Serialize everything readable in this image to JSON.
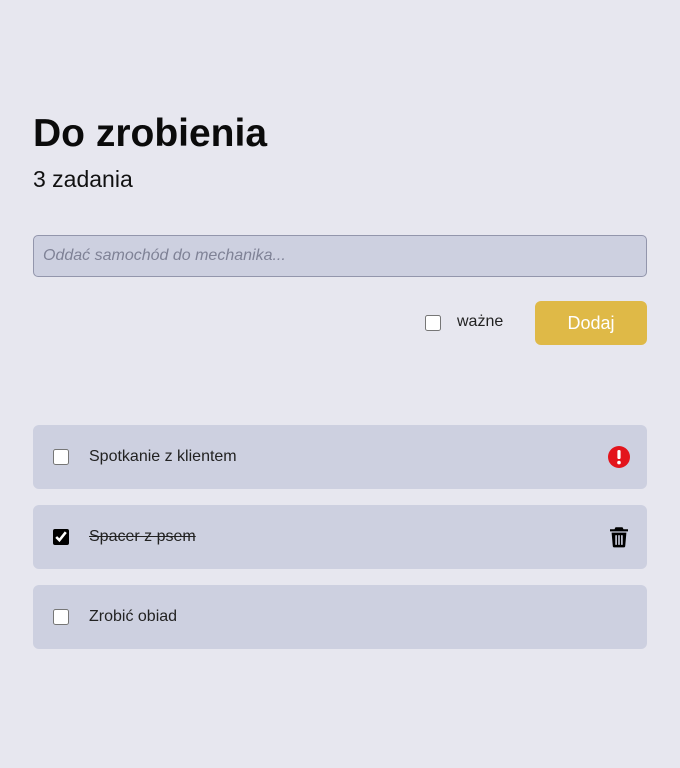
{
  "header": {
    "title": "Do zrobienia",
    "count": "3 zadania"
  },
  "form": {
    "input_placeholder": "Oddać samochód do mechanika...",
    "important_label": "ważne",
    "important_checked": false,
    "add_button_label": "Dodaj"
  },
  "tasks": [
    {
      "label": "Spotkanie z klientem",
      "done": false,
      "important": true,
      "action_icon": "exclamation-icon"
    },
    {
      "label": "Spacer z psem",
      "done": true,
      "important": false,
      "action_icon": "trash-icon"
    },
    {
      "label": "Zrobić obiad",
      "done": false,
      "important": false,
      "action_icon": ""
    }
  ],
  "colors": {
    "background": "#e7e7ef",
    "card": "#cdd0e0",
    "accent_button": "#dfb947",
    "important_icon": "#e3141c"
  }
}
